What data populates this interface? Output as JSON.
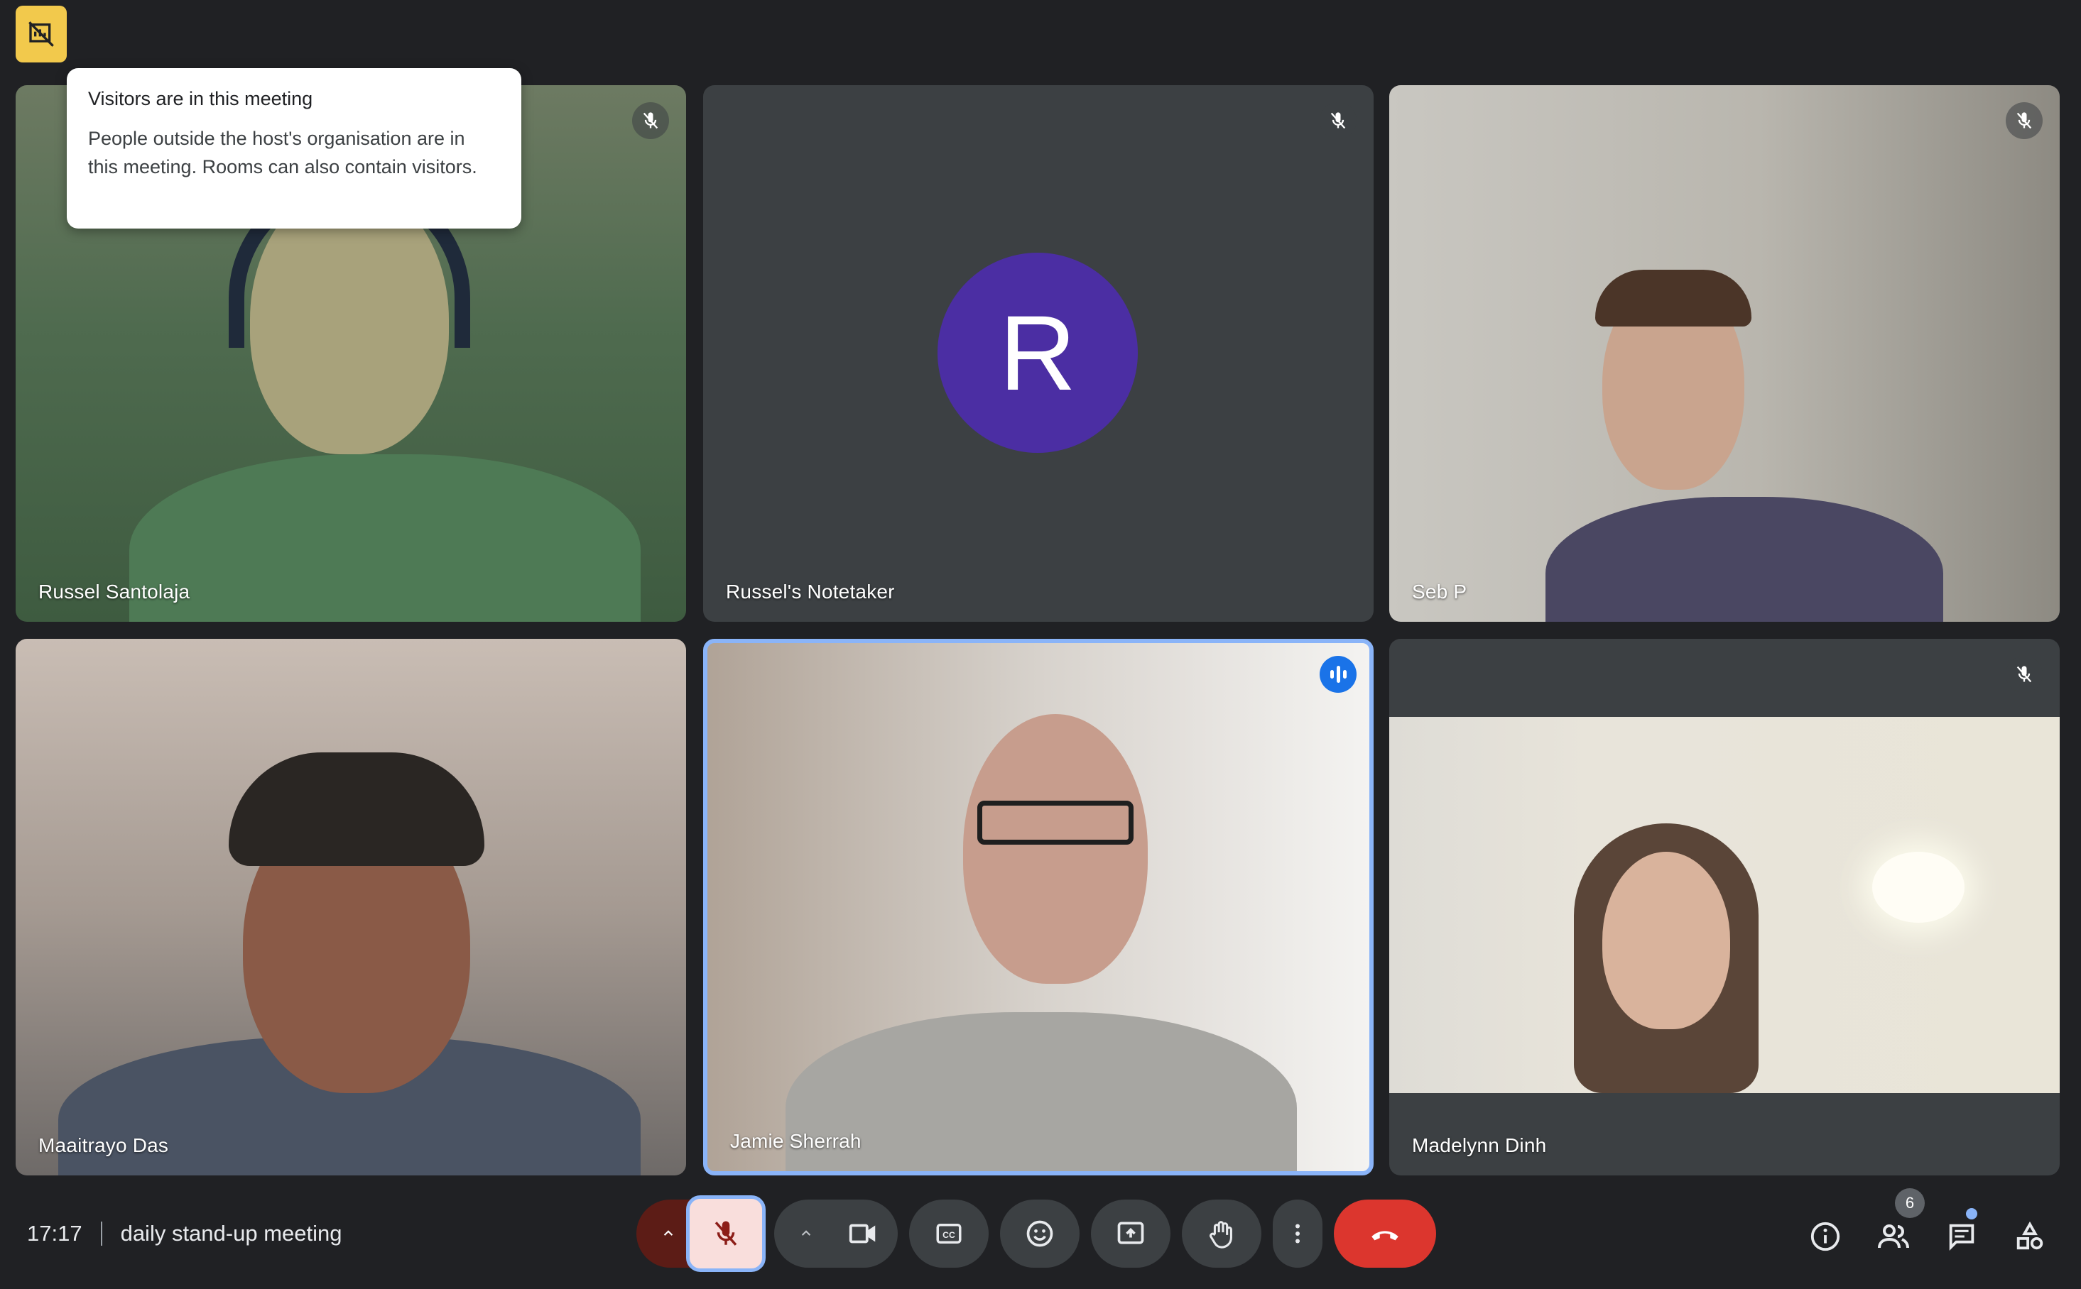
{
  "meeting": {
    "time": "17:17",
    "title": "daily stand-up meeting",
    "participant_count": "6"
  },
  "tooltip": {
    "title": "Visitors are in this meeting",
    "body": "People outside the host's organisation are in this meeting. Rooms can also contain visitors."
  },
  "participants": [
    {
      "name": "Russel Santolaja",
      "muted": true
    },
    {
      "name": "Russel's Notetaker",
      "avatar_letter": "R",
      "avatar_color": "#4b2ea3",
      "muted": true
    },
    {
      "name": "Seb P",
      "muted": true
    },
    {
      "name": "Maaitrayo Das",
      "muted": false
    },
    {
      "name": "Jamie Sherrah",
      "speaking": true
    },
    {
      "name": "Madelynn Dinh",
      "muted": true
    }
  ],
  "controls": [
    "mic-muted",
    "camera",
    "captions",
    "emoji",
    "present",
    "raise-hand",
    "more",
    "leave-call"
  ],
  "side_controls": [
    "info",
    "people",
    "chat",
    "activities"
  ],
  "colors": {
    "background": "#202124",
    "end_call": "#dc362e",
    "accent": "#8ab4f8",
    "visitor_badge": "#f2c94c"
  }
}
